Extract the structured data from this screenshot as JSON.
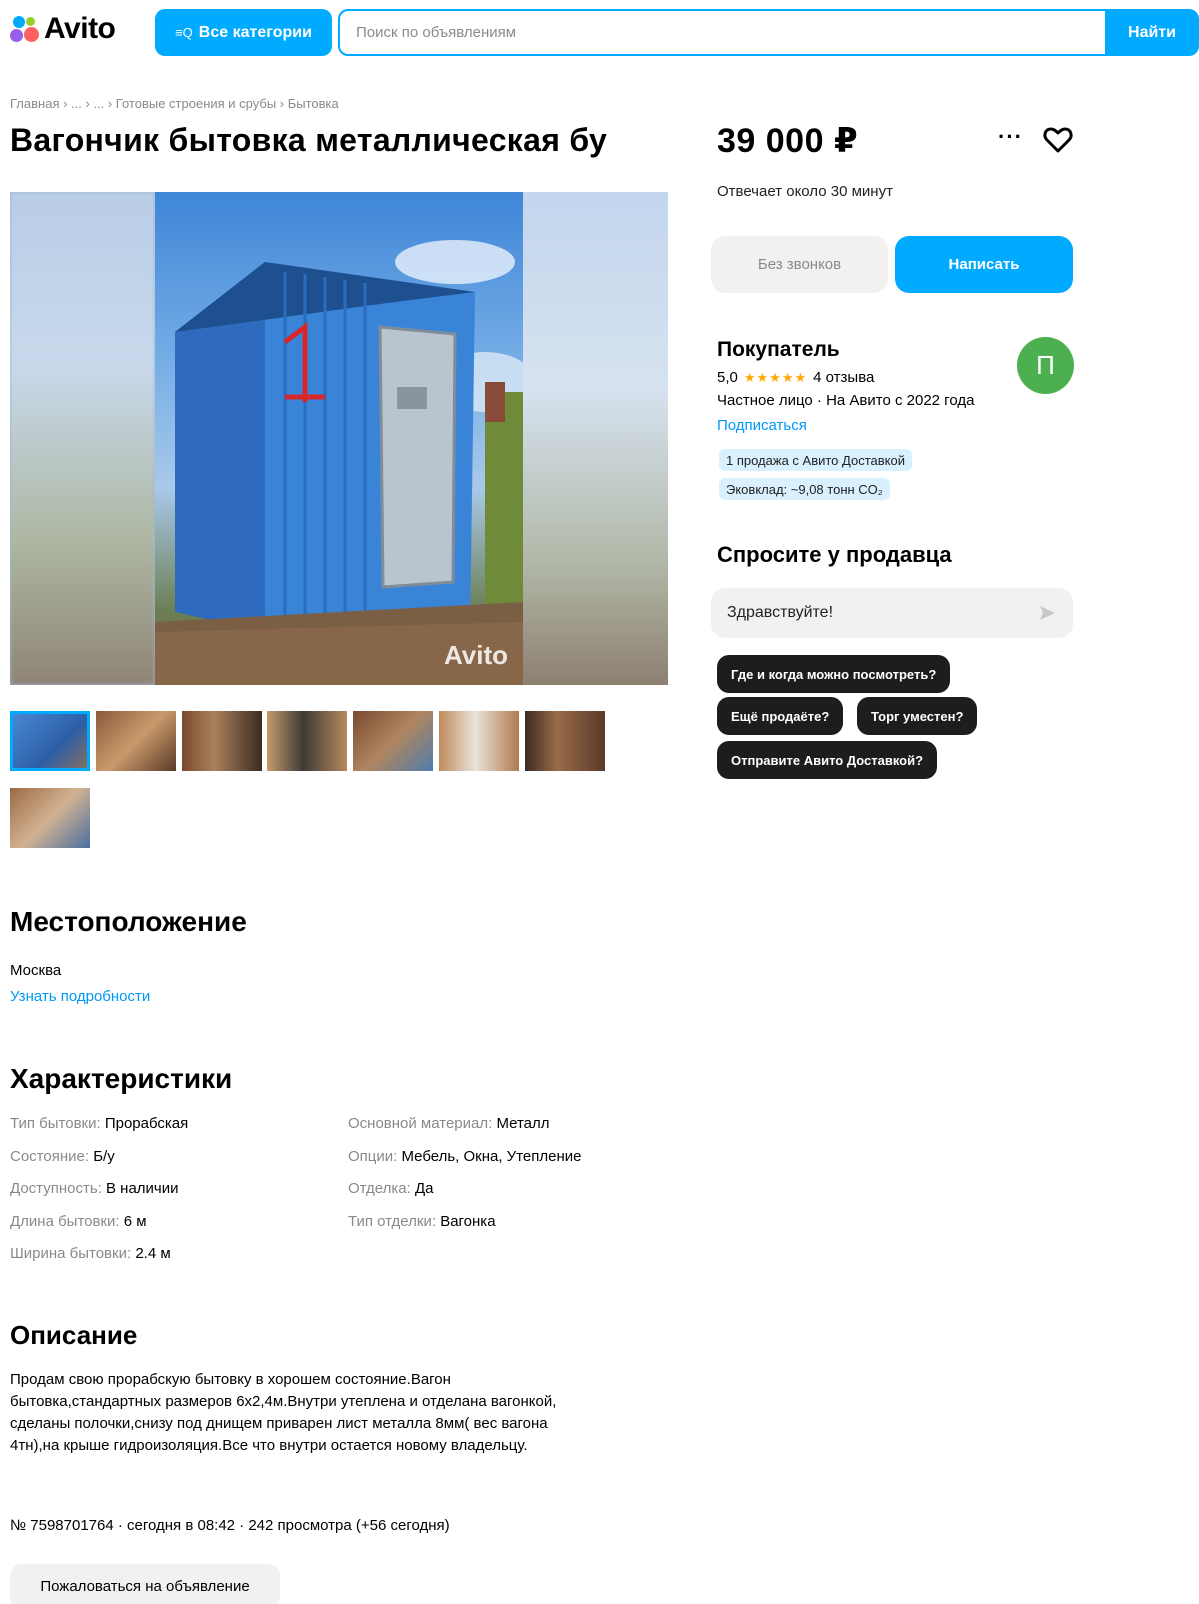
{
  "header": {
    "logo_text": "Avito",
    "categories_icon": "≡Q",
    "categories_label": "Все категории",
    "search_placeholder": "Поиск по объявлениям",
    "search_button": "Найти"
  },
  "breadcrumb": "Главная › ... › ... › Готовые строения и срубы › Бытовка",
  "listing": {
    "title": "Вагончик бытовка металлическая бу",
    "price": "39 000 ₽",
    "more_label": "···",
    "reply_time": "Отвечает около 30 минут",
    "no_calls_label": "Без звонков",
    "write_label": "Написать",
    "watermark": "Avito"
  },
  "seller": {
    "name": "Покупатель",
    "avatar_letter": "П",
    "rating": "5,0",
    "stars": "★★★★★",
    "reviews": "4 отзыва",
    "type": "Частное лицо · На Авито с 2022 года",
    "subscribe": "Подписаться",
    "tags": [
      "1 продажа с Авито Доставкой",
      "Эковклад: ~9,08 тонн CO₂"
    ]
  },
  "ask": {
    "title": "Спросите у продавца",
    "field_text": "Здравствуйте!",
    "chips": [
      "Где и когда можно посмотреть?",
      "Ещё продаёте?",
      "Торг уместен?",
      "Отправите Авито Доставкой?"
    ]
  },
  "location": {
    "title": "Местоположение",
    "city": "Москва",
    "details_link": "Узнать подробности"
  },
  "specs": {
    "title": "Характеристики",
    "items": [
      {
        "k": "Тип бытовки: ",
        "v": "Прорабская"
      },
      {
        "k": "Состояние: ",
        "v": "Б/у"
      },
      {
        "k": "Доступность: ",
        "v": "В наличии"
      },
      {
        "k": "Длина бытовки: ",
        "v": "6 м"
      },
      {
        "k": "Ширина бытовки: ",
        "v": "2.4 м"
      },
      {
        "k": "Основной материал: ",
        "v": "Металл"
      },
      {
        "k": "Опции: ",
        "v": "Мебель, Окна, Утепление"
      },
      {
        "k": "Отделка: ",
        "v": "Да"
      },
      {
        "k": "Тип отделки: ",
        "v": "Вагонка"
      }
    ]
  },
  "description": {
    "title": "Описание",
    "lines": [
      "Продам свою прорабскую бытовку в хорошем состояние.Вагон",
      "бытовка,стандартных размеров 6х2,4м.Внутри утеплена и отделана вагонкой,",
      "сделаны полочки,снизу под днищем приварен лист металла 8мм( вес вагона",
      "4тн),на крыше гидроизоляция.Все что внутри остается новому владельцу."
    ]
  },
  "meta": "№ 7598701764 · сегодня в 08:42 · 242 просмотра (+56 сегодня)",
  "report_label": "Пожаловаться на объявление",
  "colors": {
    "accent": "#00aaff",
    "link": "#0099f7",
    "avatar": "#4caf50",
    "chip": "#1d1d1d",
    "star": "#ffa800"
  }
}
